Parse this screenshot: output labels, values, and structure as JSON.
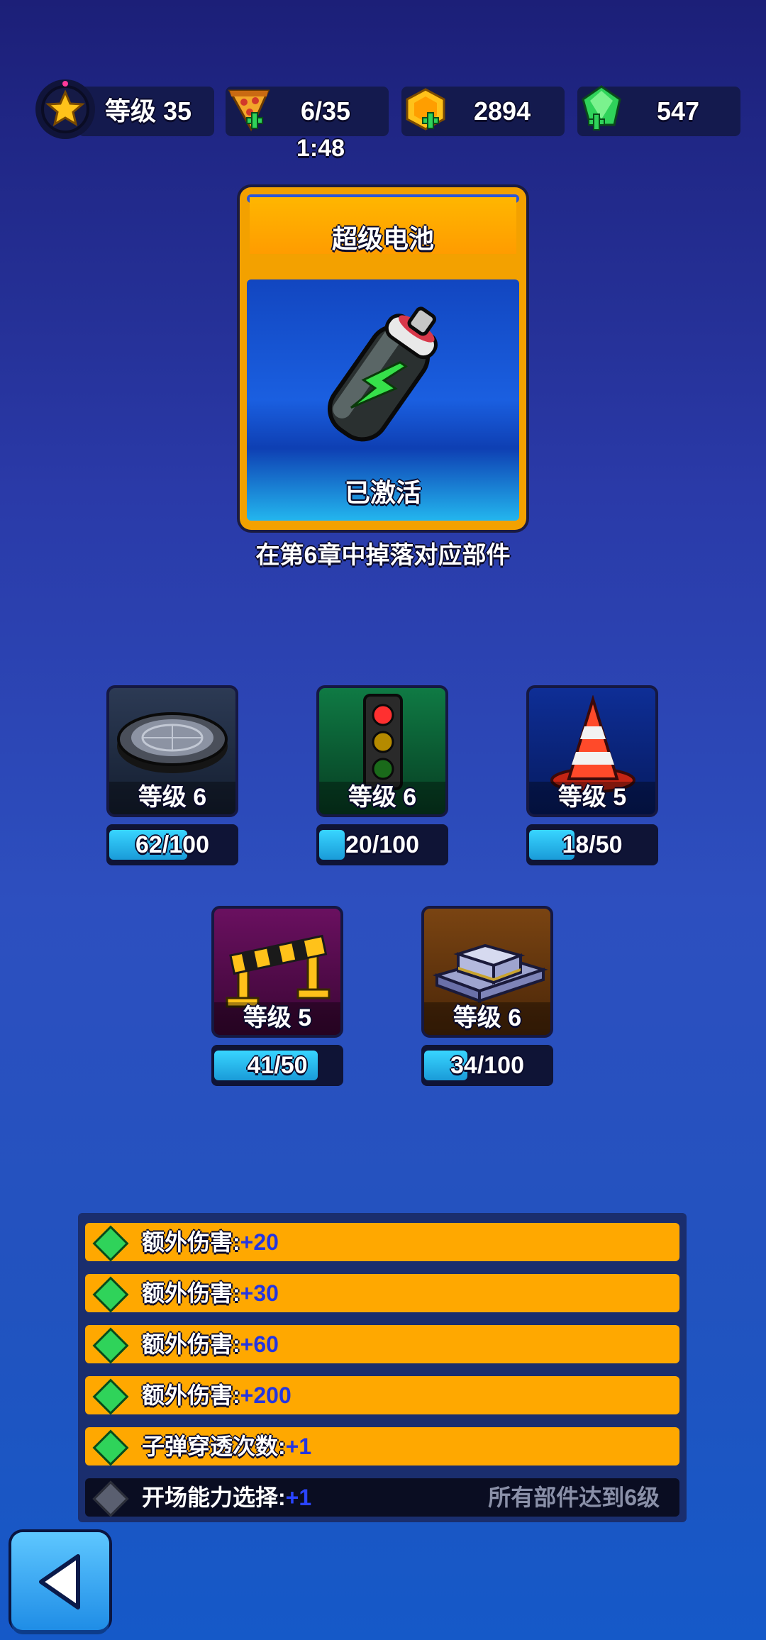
{
  "top_bar": {
    "level_label": "等级 35",
    "energy_value": "6/35",
    "energy_timer": "1:48",
    "coins_value": "2894",
    "gems_value": "547"
  },
  "card": {
    "title": "超级电池",
    "status": "已激活",
    "hint": "在第6章中掉落对应部件"
  },
  "parts": [
    {
      "name": "manhole-cover",
      "level": "等级 6",
      "progress": "62/100",
      "fraction": 0.62,
      "bg": "#1e2a40"
    },
    {
      "name": "traffic-light",
      "level": "等级 6",
      "progress": "20/100",
      "fraction": 0.2,
      "bg": "#0c6a3c"
    },
    {
      "name": "traffic-cone",
      "level": "等级 5",
      "progress": "18/50",
      "fraction": 0.36,
      "bg": "#0c2a8a"
    },
    {
      "name": "barrier",
      "level": "等级 5",
      "progress": "41/50",
      "fraction": 0.82,
      "bg": "#5a0d52"
    },
    {
      "name": "concrete-block",
      "level": "等级 6",
      "progress": "34/100",
      "fraction": 0.34,
      "bg": "#6a3a10"
    }
  ],
  "bonuses": [
    {
      "label": "额外伤害:",
      "value": "+20",
      "active": true,
      "requirement": ""
    },
    {
      "label": "额外伤害:",
      "value": "+30",
      "active": true,
      "requirement": ""
    },
    {
      "label": "额外伤害:",
      "value": "+60",
      "active": true,
      "requirement": ""
    },
    {
      "label": "额外伤害:",
      "value": "+200",
      "active": true,
      "requirement": ""
    },
    {
      "label": "子弹穿透次数:",
      "value": "+1",
      "active": true,
      "requirement": ""
    },
    {
      "label": "开场能力选择:",
      "value": "+1",
      "active": false,
      "requirement": "所有部件达到6级"
    }
  ],
  "colors": {
    "accent_orange": "#ffa800",
    "gem_green": "#2fd35a",
    "progress_cyan": "#38d5ff",
    "bonus_value_blue": "#2436e0"
  },
  "icons": [
    "star-icon",
    "pizza-icon",
    "coin-icon",
    "gem-icon",
    "battery-icon",
    "back-arrow-icon"
  ]
}
